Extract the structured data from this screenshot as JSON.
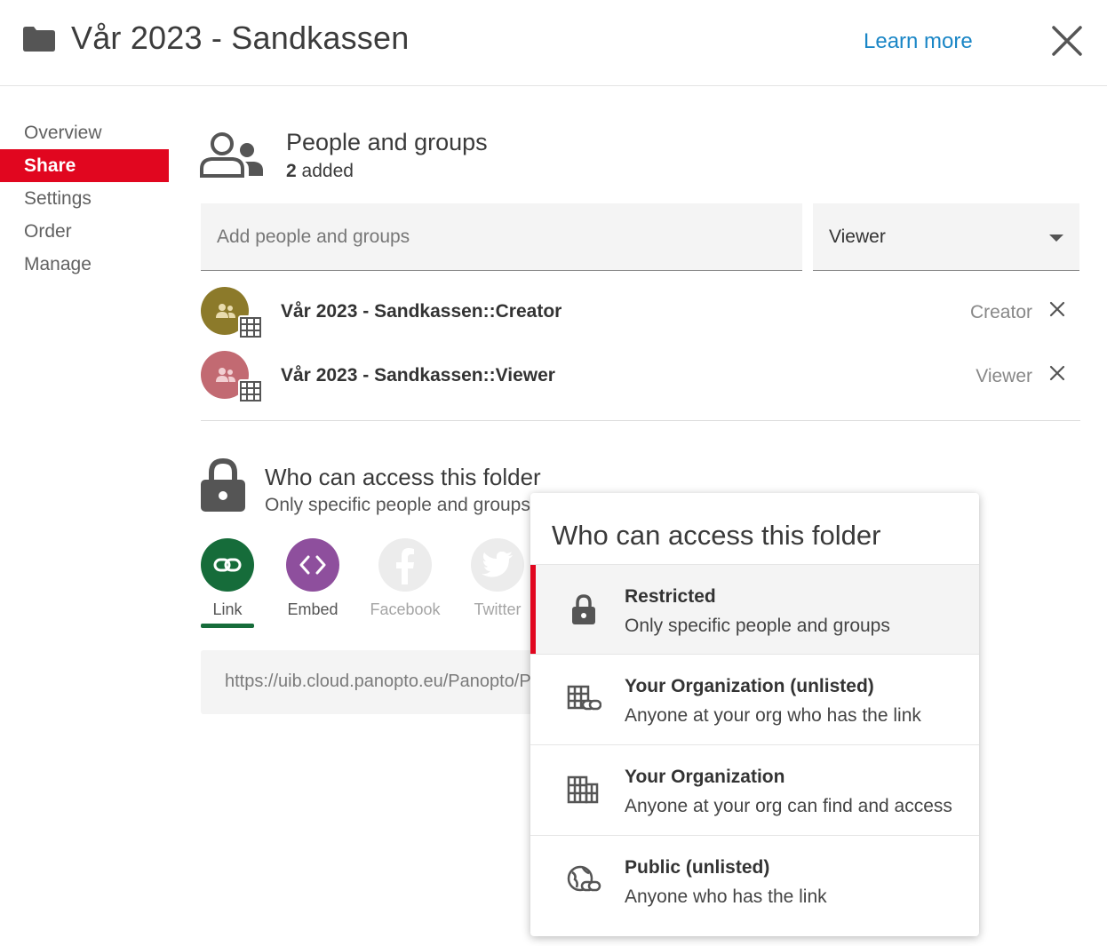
{
  "header": {
    "title": "Vår 2023 - Sandkassen",
    "learn_more": "Learn more"
  },
  "sidebar": {
    "items": [
      {
        "label": "Overview"
      },
      {
        "label": "Share",
        "active": true
      },
      {
        "label": "Settings"
      },
      {
        "label": "Order"
      },
      {
        "label": "Manage"
      }
    ]
  },
  "people": {
    "title": "People and groups",
    "count": "2",
    "count_suffix": "added",
    "add_placeholder": "Add people and groups",
    "role_selected": "Viewer",
    "members": [
      {
        "name": "Vår 2023 - Sandkassen::Creator",
        "role": "Creator",
        "color": "#8c7a2a"
      },
      {
        "name": "Vår 2023 - Sandkassen::Viewer",
        "role": "Viewer",
        "color": "#c26a72"
      }
    ]
  },
  "access": {
    "title": "Who can access this folder",
    "subtitle": "Only specific people and groups"
  },
  "share_options": [
    {
      "label": "Link",
      "color": "#166c3a",
      "active": true
    },
    {
      "label": "Embed",
      "color": "#8e4f9d"
    },
    {
      "label": "Facebook",
      "color": "#ececec"
    },
    {
      "label": "Twitter",
      "color": "#ececec"
    }
  ],
  "link_url": "https://uib.cloud.panopto.eu/Panopto/Pages/Sessions/List.aspx",
  "dropdown": {
    "title": "Who can access this folder",
    "options": [
      {
        "title": "Restricted",
        "subtitle": "Only specific people and groups",
        "icon": "lock-icon",
        "selected": true
      },
      {
        "title": "Your Organization (unlisted)",
        "subtitle": "Anyone at your org who has the link",
        "icon": "building-link-icon"
      },
      {
        "title": "Your Organization",
        "subtitle": "Anyone at your org can find and access",
        "icon": "building-icon"
      },
      {
        "title": "Public (unlisted)",
        "subtitle": "Anyone who has the link",
        "icon": "globe-link-icon"
      }
    ]
  },
  "colors": {
    "accent_red": "#e1061f",
    "link_blue": "#1a86c6",
    "link_green": "#166c3a"
  }
}
